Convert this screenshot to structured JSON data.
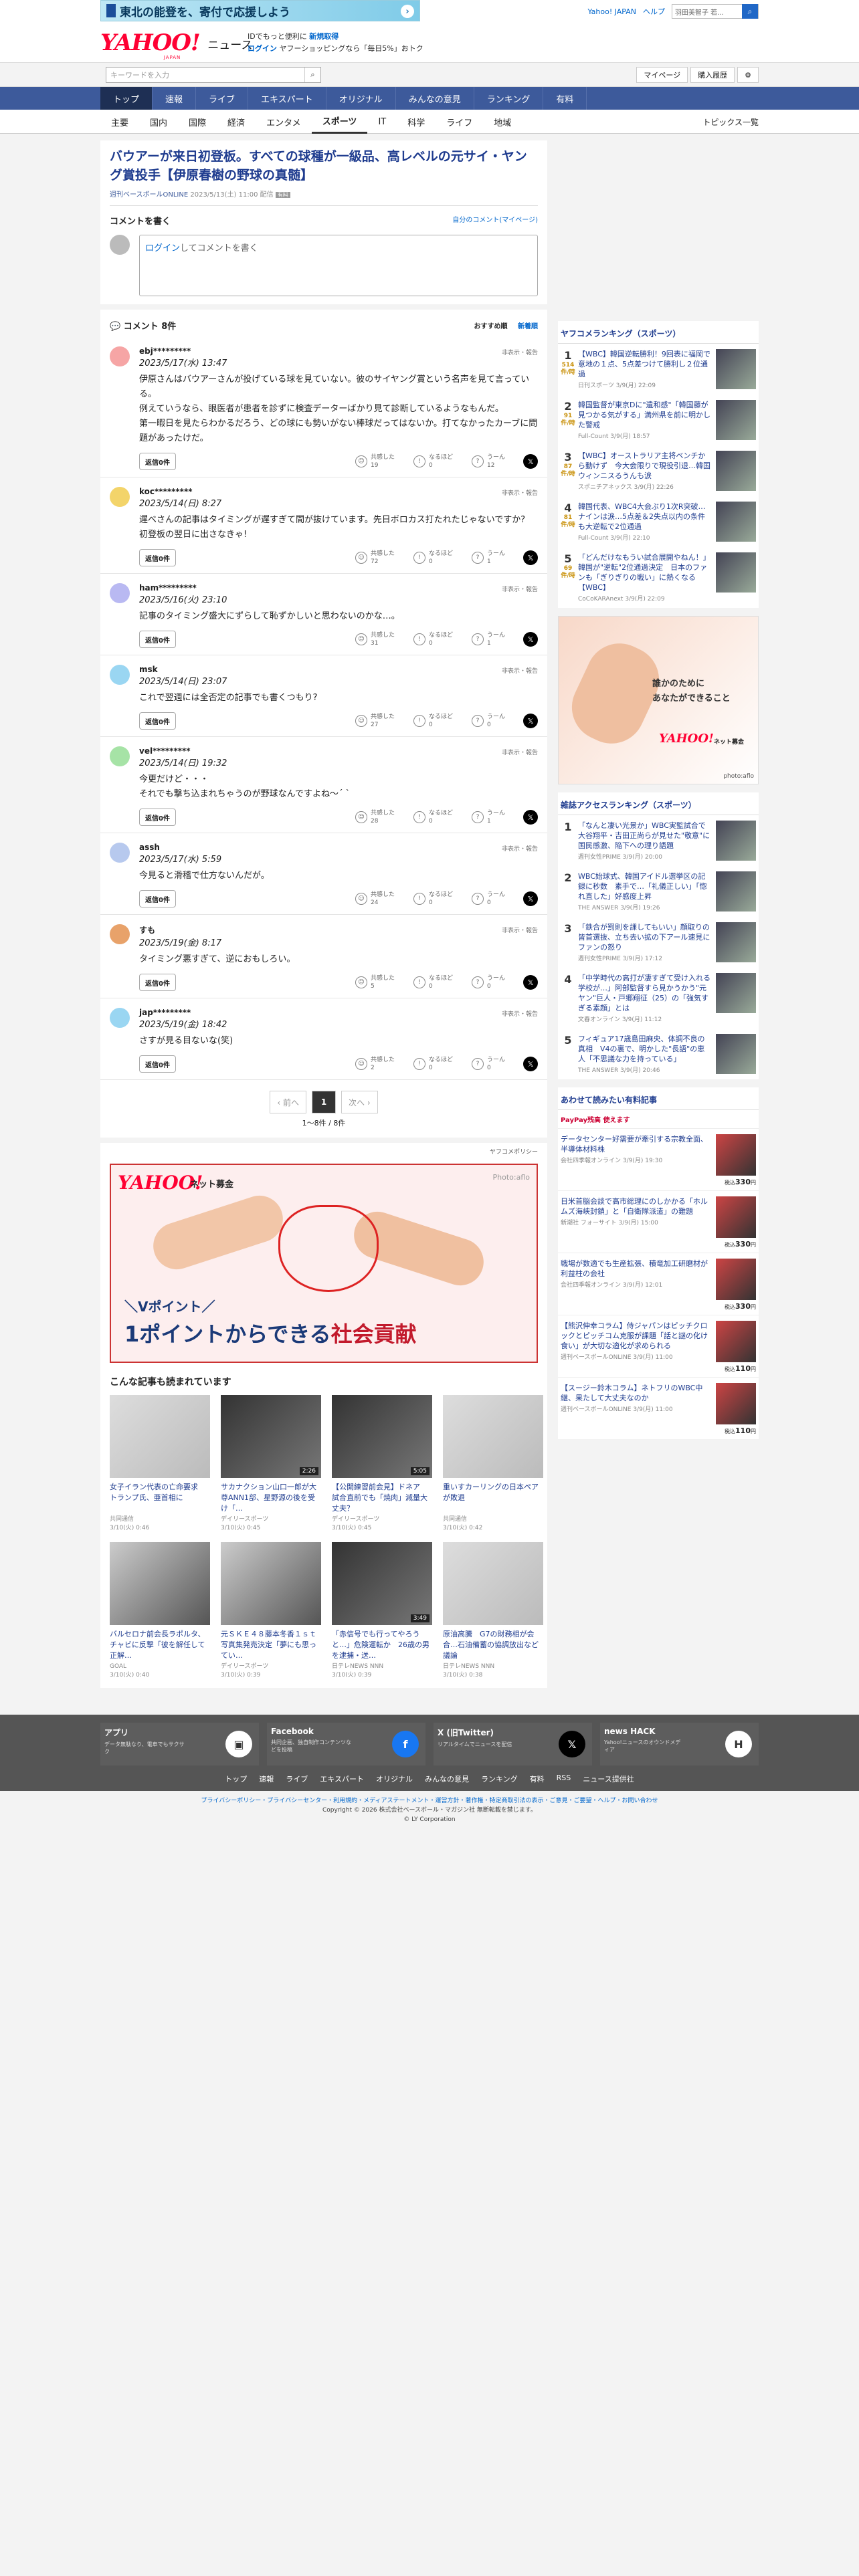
{
  "banner": {
    "text": "東北の能登を、寄付で応援しよう",
    "arrow": "›"
  },
  "toplinks": {
    "yahoo_japan": "Yahoo! JAPAN",
    "help": "ヘルプ",
    "web_search_placeholder": "ウェブ検索",
    "web_search_value": "羽田美智子 若...",
    "search_icon": "search-icon"
  },
  "logo": {
    "yahoo": "YAHOO!",
    "japan": "JAPAN",
    "news": "ニュース"
  },
  "promo": {
    "line1": "IDでもっと便利に",
    "line1_link": "新規取得",
    "line2_link": "ログイン",
    "line2": "ヤフーショッピングなら「毎日5%」おトク"
  },
  "search": {
    "placeholder": "キーワードを入力",
    "mypage": "マイページ",
    "purchased": "購入履歴",
    "settings_icon": "gear-icon"
  },
  "nav": [
    "トップ",
    "速報",
    "ライブ",
    "エキスパート",
    "オリジナル",
    "みんなの意見",
    "ランキング",
    "有料"
  ],
  "subnav": {
    "items": [
      "主要",
      "国内",
      "国際",
      "経済",
      "エンタメ",
      "スポーツ",
      "IT",
      "科学",
      "ライフ",
      "地域"
    ],
    "more": "トピックス一覧"
  },
  "article": {
    "title": "バウアーが来日初登板。すべての球種が一級品、高レベルの元サイ・ヤング賞投手【伊原春樹の野球の真髄】",
    "source": "週刊ベースボールONLINE",
    "date": "2023/5/13(土) 11:00",
    "delivered": "配信",
    "badge": "有料"
  },
  "comment_write": {
    "heading": "コメントを書く",
    "my_comments": "自分のコメント(マイページ)",
    "login": "ログイン",
    "prompt": "してコメントを書く"
  },
  "comments_header": {
    "title": "コメント 8件",
    "sort_recommended": "おすすめ順",
    "sort_newest": "新着順"
  },
  "comments": [
    {
      "user": "ebj*********",
      "date": "2023/5/17(水) 13:47",
      "report": "非表示・報告",
      "text": "伊原さんはバウアーさんが投げている球を見ていない。彼のサイヤング賞という名声を見て言っている。\n例えていうなら、眼医者が患者を診ずに検査データーばかり見て診断しているようなもんだ。\n第一暇日を見たらわかるだろう、どの球にも勢いがない棒球だってはないか。打てなかったカーブに問題があったけだ。",
      "reply": "返信0件",
      "agree": "19",
      "insight": "0",
      "hmm": "12"
    },
    {
      "user": "koc*********",
      "date": "2023/5/14(日) 8:27",
      "report": "非表示・報告",
      "text": "遅べさんの記事はタイミングが遅すぎて間が抜けています。先日ボロカス打たれたじゃないですか?\n初登板の翌日に出さなきゃ!",
      "reply": "返信0件",
      "agree": "72",
      "insight": "0",
      "hmm": "1"
    },
    {
      "user": "ham*********",
      "date": "2023/5/16(火) 23:10",
      "report": "非表示・報告",
      "text": "記事のタイミング盛大にずらして恥ずかしいと思わないのかな…。",
      "reply": "返信0件",
      "agree": "31",
      "insight": "0",
      "hmm": "1"
    },
    {
      "user": "msk",
      "date": "2023/5/14(日) 23:07",
      "report": "非表示・報告",
      "text": "これで翌週には全否定の記事でも書くつもり?",
      "reply": "返信0件",
      "agree": "27",
      "insight": "0",
      "hmm": "0"
    },
    {
      "user": "vel*********",
      "date": "2023/5/14(日) 19:32",
      "report": "非表示・報告",
      "text": "今更だけど・・・\nそれでも撃ち込まれちゃうのが野球なんですよね〜´ ` ",
      "reply": "返信0件",
      "agree": "28",
      "insight": "0",
      "hmm": "1"
    },
    {
      "user": "assh",
      "date": "2023/5/17(水) 5:59",
      "report": "非表示・報告",
      "text": "今見ると滑稽で仕方ないんだが。",
      "reply": "返信0件",
      "agree": "24",
      "insight": "0",
      "hmm": "0"
    },
    {
      "user": "すも",
      "date": "2023/5/19(金) 8:17",
      "report": "非表示・報告",
      "text": "タイミング悪すぎて、逆におもしろい。",
      "reply": "返信0件",
      "agree": "5",
      "insight": "0",
      "hmm": "0"
    },
    {
      "user": "jap*********",
      "date": "2023/5/19(金) 18:42",
      "report": "非表示・報告",
      "text": "さすが見る目ないな(笑)",
      "reply": "返信0件",
      "agree": "2",
      "insight": "0",
      "hmm": "0"
    }
  ],
  "react_labels": {
    "agree": "共感した",
    "insight": "なるほど",
    "hmm": "うーん"
  },
  "pager": {
    "prev": "‹ 前へ",
    "current": "1",
    "next": "次へ ›",
    "count": "1〜8件 / 8件"
  },
  "policy": "ヤフコメポリシー",
  "big_ad": {
    "yahoo": "YAHOO!",
    "sub": "ネット募金",
    "photo": "Photo:aflo",
    "line1": "＼Vポイント／",
    "line2a": "1ポイントからできる",
    "line2b": "社会貢献"
  },
  "recommend": {
    "title": "こんな記事も読まれています",
    "items": [
      {
        "title": "女子イラン代表の亡命要求　トランプ氏、亜首相に",
        "src": "共同通信",
        "time": "3/10(火) 0:46",
        "dur": ""
      },
      {
        "title": "サカナクション山口一郎が大尊ANN1部、星野源の後を受け「…",
        "src": "デイリースポーツ",
        "time": "3/10(火) 0:45",
        "dur": "2:26"
      },
      {
        "title": "【公開練習前会見】ドネア　試合直前でも「焼肉」減量大丈夫？",
        "src": "デイリースポーツ",
        "time": "3/10(火) 0:45",
        "dur": "5:05"
      },
      {
        "title": "重いすカーリングの日本ペアが敗退",
        "src": "共同通信",
        "time": "3/10(火) 0:42",
        "dur": ""
      },
      {
        "title": "バルセロナ前会長ラポルタ、チャビに反撃「彼を解任して正解…",
        "src": "GOAL",
        "time": "3/10(火) 0:40",
        "dur": ""
      },
      {
        "title": "元ＳＫＥ４８藤本冬香１ｓｔ写真集発売決定「夢にも思ってい…",
        "src": "デイリースポーツ",
        "time": "3/10(火) 0:39",
        "dur": ""
      },
      {
        "title": "「赤信号でも行ってやろうと…」危険運転か　26歳の男を逮捕・送…",
        "src": "日テレNEWS NNN",
        "time": "3/10(火) 0:39",
        "dur": "3:49"
      },
      {
        "title": "原油高騰　G7の財務相が会合…石油備蓄の協調放出など議論",
        "src": "日テレNEWS NNN",
        "time": "3/10(火) 0:38",
        "dur": ""
      }
    ]
  },
  "ranking": {
    "title": "ヤフコメランキング（スポーツ）",
    "items": [
      {
        "rank": "1",
        "count": "514",
        "unit": "件/時",
        "title": "【WBC】韓国逆転勝利！9回表に福岡で意地の１点、5点差つけて勝利し２位通過",
        "src": "日刊スポーツ 3/9(月) 22:09"
      },
      {
        "rank": "2",
        "count": "91",
        "unit": "件/時",
        "title": "韓国監督が東京Dに\"遺和感\"「韓国藤が見つかる気がする」満州県を前に明かした警戒",
        "src": "Full-Count 3/9(月) 18:57"
      },
      {
        "rank": "3",
        "count": "87",
        "unit": "件/時",
        "title": "【WBC】オーストラリア主将ベンチから動けず　今大会限りで現役引退…韓国ウィンニスるうんも涙",
        "src": "スポニチアネックス 3/9(月) 22:26"
      },
      {
        "rank": "4",
        "count": "81",
        "unit": "件/時",
        "title": "韓国代表、WBC4大会ぶり1次R突破…ナインは涙…5点差＆2失点以内の条件も大逆転で2位通過",
        "src": "Full-Count 3/9(月) 22:10"
      },
      {
        "rank": "5",
        "count": "69",
        "unit": "件/時",
        "title": "「どんだけなもうい試合展開やねん！」韓国が\"逆転\"2位通過決定　日本のファンも「ぎりぎりの戦い」に熱くなる【WBC】",
        "src": "CoCoKARAnext 3/9(月) 22:09"
      }
    ]
  },
  "side_ad": {
    "line1": "誰かのために",
    "line2": "あなたができること",
    "yahoo": "YAHOO!",
    "sub": "ネット募金",
    "photo": "photo:aflo"
  },
  "access": {
    "title": "雑誌アクセスランキング（スポーツ）",
    "items": [
      {
        "rank": "1",
        "title": "「なんと凄い光景か」WBC実監試合で大谷翔平・吉田正尚らが見せた\"敬意\"に国民感激、陥下への理り語題",
        "src": "週刊女性PRIME 3/9(月) 20:00"
      },
      {
        "rank": "2",
        "title": "WBC始球式、韓国アイドル選挙区の記録に秒数　素手で…「礼儀正しい」「惚れ直した」好感度上昇",
        "src": "THE ANSWER 3/9(月) 19:26"
      },
      {
        "rank": "3",
        "title": "「鉄合が罰則を課してもいい」顔取りの皆首選抜、立ち去い拡の下アール速見にファンの怒り",
        "src": "週刊女性PRIME 3/9(月) 17:12"
      },
      {
        "rank": "4",
        "title": "「中学時代の高打が凄すぎて受け入れる学校が…」阿部監督すら見かうかう\"元ヤン\"巨人・戸郷翔征（25）の「強気すぎる素顔」とは",
        "src": "文春オンライン 3/9(月) 11:12"
      },
      {
        "rank": "5",
        "title": "フィギュア17歳島田麻央、体調不良の真相　V4の裏で、明かした\"長語\"の恵人「不思議な力を持っている」",
        "src": "THE ANSWER 3/9(月) 20:46"
      }
    ]
  },
  "paid": {
    "title": "あわせて読みたい有料記事",
    "paypay": "PayPay残高 使えます",
    "items": [
      {
        "title": "データセンター好需要が牽引する宗教全面、半導体材料株",
        "src": "会社四季報オンライン 3/9(月) 19:30",
        "price": "330",
        "unit": "税込"
      },
      {
        "title": "日米首脳会談で高市総理にのしかかる「ホルムズ海峡封鎖」と「自衛隊派遣」の難題",
        "src": "新潮社 フォーサイト 3/9(月) 15:00",
        "price": "330",
        "unit": "税込"
      },
      {
        "title": "戦場が数適でも生産拡張、積竜加工研磨材が利益柱の会社",
        "src": "会社四季報オンライン 3/9(月) 12:01",
        "price": "330",
        "unit": "税込"
      },
      {
        "title": "【熊沢伸幸コラム】侍ジャパンはピッチクロックとピッチコム克服が課題「話と謎の化け食い」が大切な適化が求められる",
        "src": "週刊ベースボールONLINE 3/9(月) 11:00",
        "price": "110",
        "unit": "税込"
      },
      {
        "title": "【スージー鈴木コラム】ネトフリのWBC中継、果たして大丈夫なのか",
        "src": "週刊ベースボールONLINE 3/9(月) 11:00",
        "price": "110",
        "unit": "税込"
      }
    ]
  },
  "footer": {
    "cards": [
      {
        "title": "アプリ",
        "text": "データ無駄なり、電車でもサクサク",
        "icon": "app-icon"
      },
      {
        "title": "Facebook",
        "text": "共同企画、独自制作コンテンツなどを投稿",
        "icon": "facebook-icon"
      },
      {
        "title": "X (旧Twitter)",
        "text": "リアルタイムでニュースを配信",
        "icon": "x-icon"
      },
      {
        "title": "news HACK",
        "text": "Yahoo!ニュースのオウンドメディア",
        "icon": "newshack-icon"
      }
    ],
    "nav": [
      "トップ",
      "速報",
      "ライブ",
      "エキスパート",
      "オリジナル",
      "みんなの意見",
      "ランキング",
      "有料",
      "RSS",
      "ニュース提供社"
    ],
    "links": "プライバシーポリシー・プライバシーセンター・利用規約・メディアステートメント・運営方針・著作権・特定商取引法の表示・ご意見・ご要望・ヘルプ・お問い合わせ",
    "copyright": "Copyright © 2026 株式会社ベースボール・マガジン社 無断転載を禁じます。",
    "corp": "© LY Corporation"
  }
}
